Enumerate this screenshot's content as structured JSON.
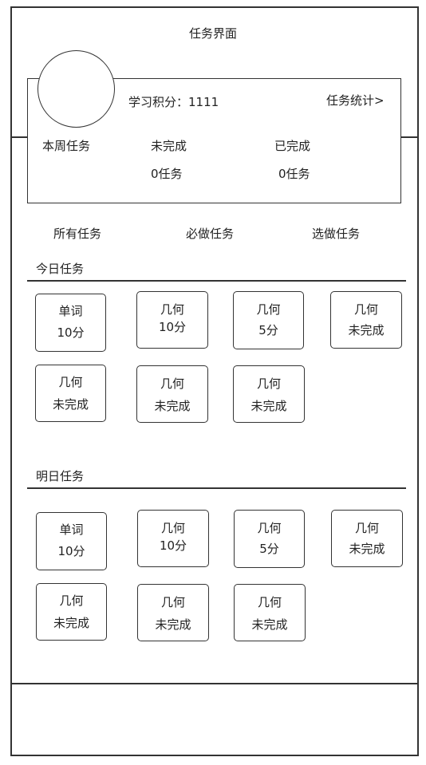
{
  "header": {
    "title": "任务界面"
  },
  "profile": {
    "score_text": "学习积分：1111",
    "stats_link": "任务统计>",
    "week_label": "本周任务",
    "incomplete_label": "未完成",
    "incomplete_count": "0任务",
    "done_label": "已完成",
    "done_count": "0任务"
  },
  "filters": {
    "all": "所有任务",
    "required": "必做任务",
    "optional": "选做任务"
  },
  "today": {
    "title": "今日任务",
    "tasks": [
      {
        "name": "单词",
        "status": "10分"
      },
      {
        "name": "几何",
        "status": "10分"
      },
      {
        "name": "几何",
        "status": "5分"
      },
      {
        "name": "几何",
        "status": "未完成"
      },
      {
        "name": "几何",
        "status": "未完成"
      },
      {
        "name": "几何",
        "status": "未完成"
      },
      {
        "name": "几何",
        "status": "未完成"
      }
    ]
  },
  "tomorrow": {
    "title": "明日任务",
    "tasks": [
      {
        "name": "单词",
        "status": "10分"
      },
      {
        "name": "几何",
        "status": "10分"
      },
      {
        "name": "几何",
        "status": "5分"
      },
      {
        "name": "几何",
        "status": "未完成"
      },
      {
        "name": "几何",
        "status": "未完成"
      },
      {
        "name": "几何",
        "status": "未完成"
      },
      {
        "name": "几何",
        "status": "未完成"
      }
    ]
  }
}
